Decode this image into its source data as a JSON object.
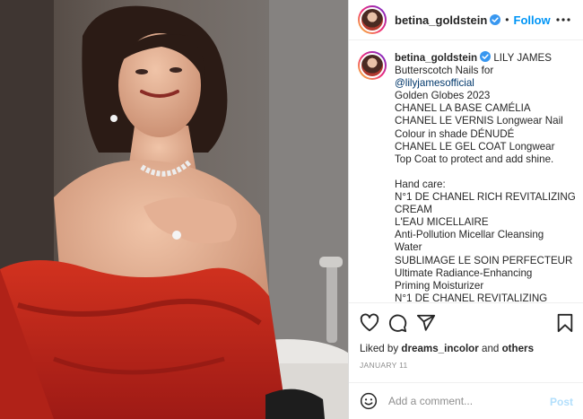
{
  "post": {
    "username": "betina_goldstein",
    "follow_label": "Follow",
    "dot": "•"
  },
  "caption": {
    "username": "betina_goldstein",
    "lines": [
      "LILY JAMES",
      "Butterscotch Nails for",
      "@lilyjamesofficial",
      "Golden Globes 2023",
      "CHANEL LA BASE CAMÉLIA",
      "CHANEL LE VERNIS Longwear Nail",
      "Colour in shade DÉNUDÉ",
      "CHANEL LE GEL COAT Longwear",
      "Top Coat to protect and add shine.",
      "",
      "Hand care:",
      "N°1 DE CHANEL RICH REVITALIZING",
      "CREAM",
      "L'EAU MICELLAIRE",
      "Anti-Pollution Micellar Cleansing",
      "Water",
      "SUBLIMAGE LE SOIN PERFECTEUR",
      "Ultimate Radiance-Enhancing",
      "Priming Moisturizer",
      "N°1 DE CHANEL REVITALIZING"
    ]
  },
  "likes": {
    "prefix": "Liked by",
    "user": "dreams_incolor",
    "and": "and",
    "others": "others"
  },
  "date": "JANUARY 11",
  "comment": {
    "placeholder": "Add a comment...",
    "post_label": "Post"
  },
  "icons": {
    "verified": "verified-badge-icon",
    "more": "more-options-icon",
    "like": "heart-icon",
    "comment": "comment-bubble-icon",
    "share": "paper-plane-icon",
    "save": "bookmark-icon",
    "emoji": "emoji-smile-icon"
  },
  "colors": {
    "accent": "#0095f6",
    "verified": "#3897f0",
    "post_disabled": "#b2dffc",
    "muted": "#8e8e8e",
    "dress": "#c8281f"
  }
}
